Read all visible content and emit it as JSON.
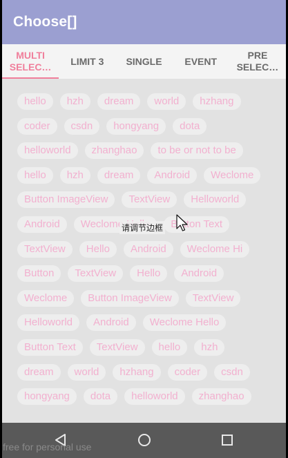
{
  "app": {
    "title": "Choose[]"
  },
  "tabs": [
    {
      "label": "MULTI\nSELEC…",
      "active": true
    },
    {
      "label": "LIMIT 3",
      "active": false
    },
    {
      "label": "SINGLE",
      "active": false
    },
    {
      "label": "EVENT",
      "active": false
    },
    {
      "label": "PRE\nSELEC…",
      "active": false
    }
  ],
  "tag_rows": [
    [
      "hello",
      "hzh",
      "dream",
      "world",
      "hzhang"
    ],
    [
      "coder",
      "csdn",
      "hongyang",
      "dota"
    ],
    [
      "helloworld",
      "zhanghao",
      "to be or not to be"
    ],
    [
      "hello",
      "hzh",
      "dream",
      "Android",
      "Weclome"
    ],
    [
      "Button ImageView",
      "TextView",
      "Helloworld"
    ],
    [
      "Android",
      "Weclome Hello",
      "Button Text"
    ],
    [
      "TextView",
      "Hello",
      "Android",
      "Weclome Hi"
    ],
    [
      "Button",
      "TextView",
      "Hello",
      "Android"
    ],
    [
      "Weclome",
      "Button ImageView",
      "TextView"
    ],
    [
      "Helloworld",
      "Android",
      "Weclome Hello"
    ],
    [
      "Button Text",
      "TextView",
      "hello",
      "hzh"
    ],
    [
      "dream",
      "world",
      "hzhang",
      "coder",
      "csdn"
    ],
    [
      "hongyang",
      "dota",
      "helloworld",
      "zhanghao"
    ]
  ],
  "toast": {
    "text": "请调节边框"
  },
  "navbar": {
    "back_icon": "back-triangle-icon",
    "home_icon": "home-circle-icon",
    "recents_icon": "recents-square-icon"
  },
  "watermark": {
    "text": "free for personal use"
  },
  "colors": {
    "appbar": "#9b9fd1",
    "accent": "#f07e9b",
    "tag_text": "#f2b0cf",
    "tag_bg": "#eeeeee",
    "navbar": "#595959"
  }
}
